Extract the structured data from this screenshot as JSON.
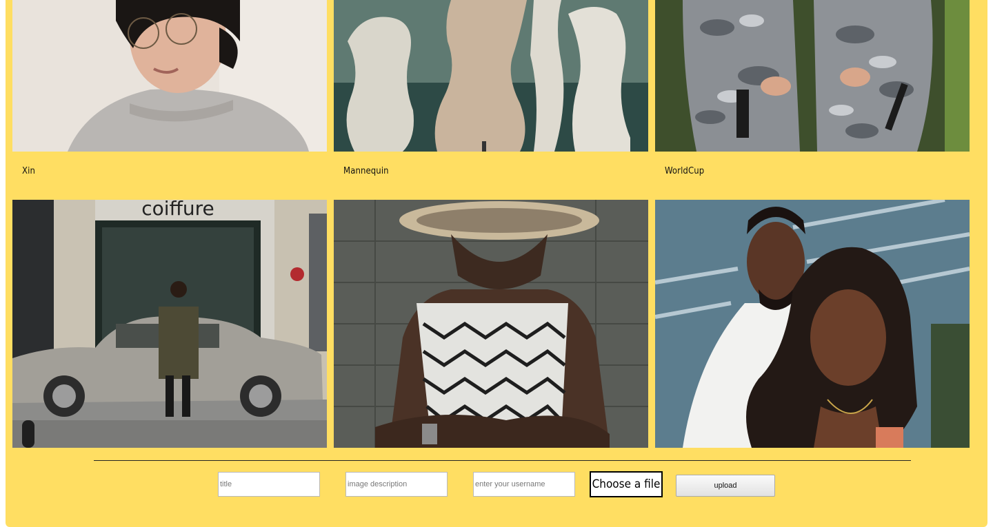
{
  "gallery": {
    "items": [
      {
        "title": "Xin"
      },
      {
        "title": "Mannequin"
      },
      {
        "title": "WorldCup"
      },
      {
        "title": ""
      },
      {
        "title": ""
      },
      {
        "title": ""
      }
    ],
    "storefront_sign": "coiffure"
  },
  "upload_form": {
    "title_placeholder": "title",
    "description_placeholder": "image description",
    "username_placeholder": "enter your username",
    "file_button_label": "Choose a file",
    "upload_button_label": "upload"
  },
  "colors": {
    "page_background": "#ffde62",
    "divider": "#222222"
  }
}
